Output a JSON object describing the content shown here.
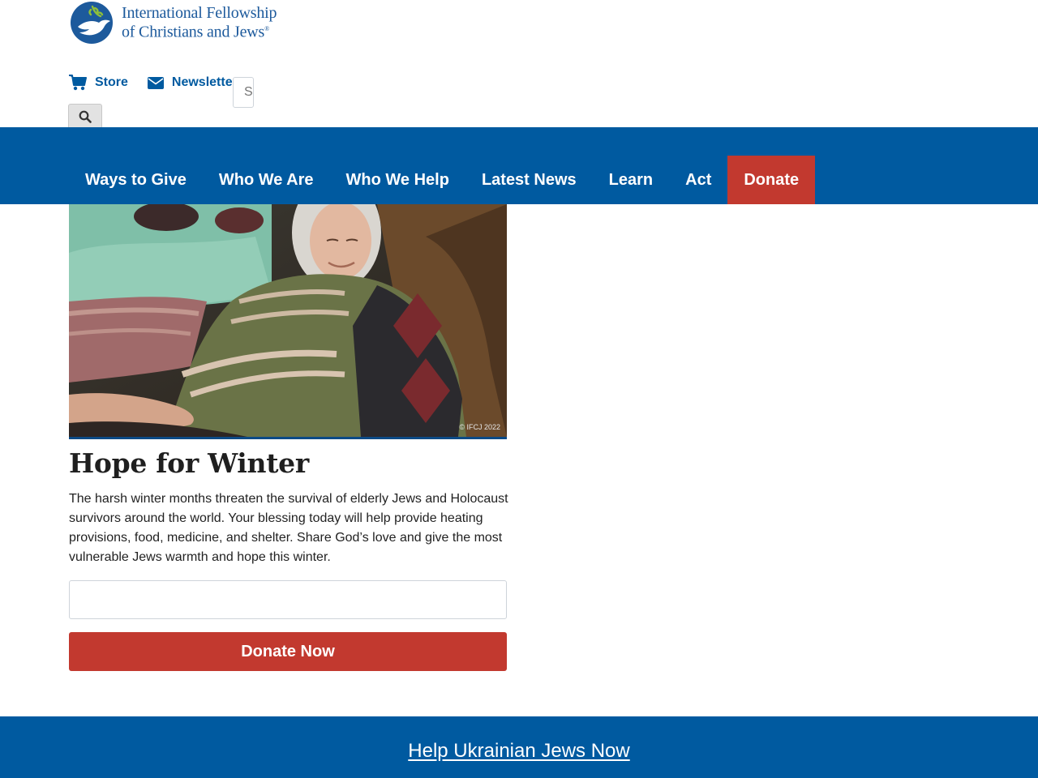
{
  "brand": {
    "name_line1": "International Fellowship",
    "name_line2": "of Christians and Jews",
    "mark": "®",
    "color": "#1d5a9c"
  },
  "utility_nav": {
    "store_label": "Store",
    "newsletter_label": "Newsletter",
    "search_placeholder": "Search",
    "icons": {
      "store": "cart-icon",
      "newsletter": "envelope-icon",
      "search": "search-icon"
    }
  },
  "main_nav": {
    "items": [
      {
        "label": "Ways to Give"
      },
      {
        "label": "Who We Are"
      },
      {
        "label": "Who We Help"
      },
      {
        "label": "Latest News"
      },
      {
        "label": "Learn"
      },
      {
        "label": "Act"
      },
      {
        "label": "Donate"
      }
    ]
  },
  "hero": {
    "copyright": "© IFCJ 2022"
  },
  "campaign": {
    "title": "Hope for Winter",
    "body": "The harsh winter months threaten the survival of elderly Jews and Holocaust survivors around the world. Your blessing today will help provide heating provisions, food, medicine, and shelter. Share God’s love and give the most vulnerable Jews warmth and hope this winter.",
    "amount_value": "",
    "donate_label": "Donate Now"
  },
  "footer_banner": {
    "link_label": "Help Ukrainian Jews Now"
  },
  "colors": {
    "primary_blue": "#005aa0",
    "donate_red": "#c2392f",
    "white": "#ffffff"
  }
}
